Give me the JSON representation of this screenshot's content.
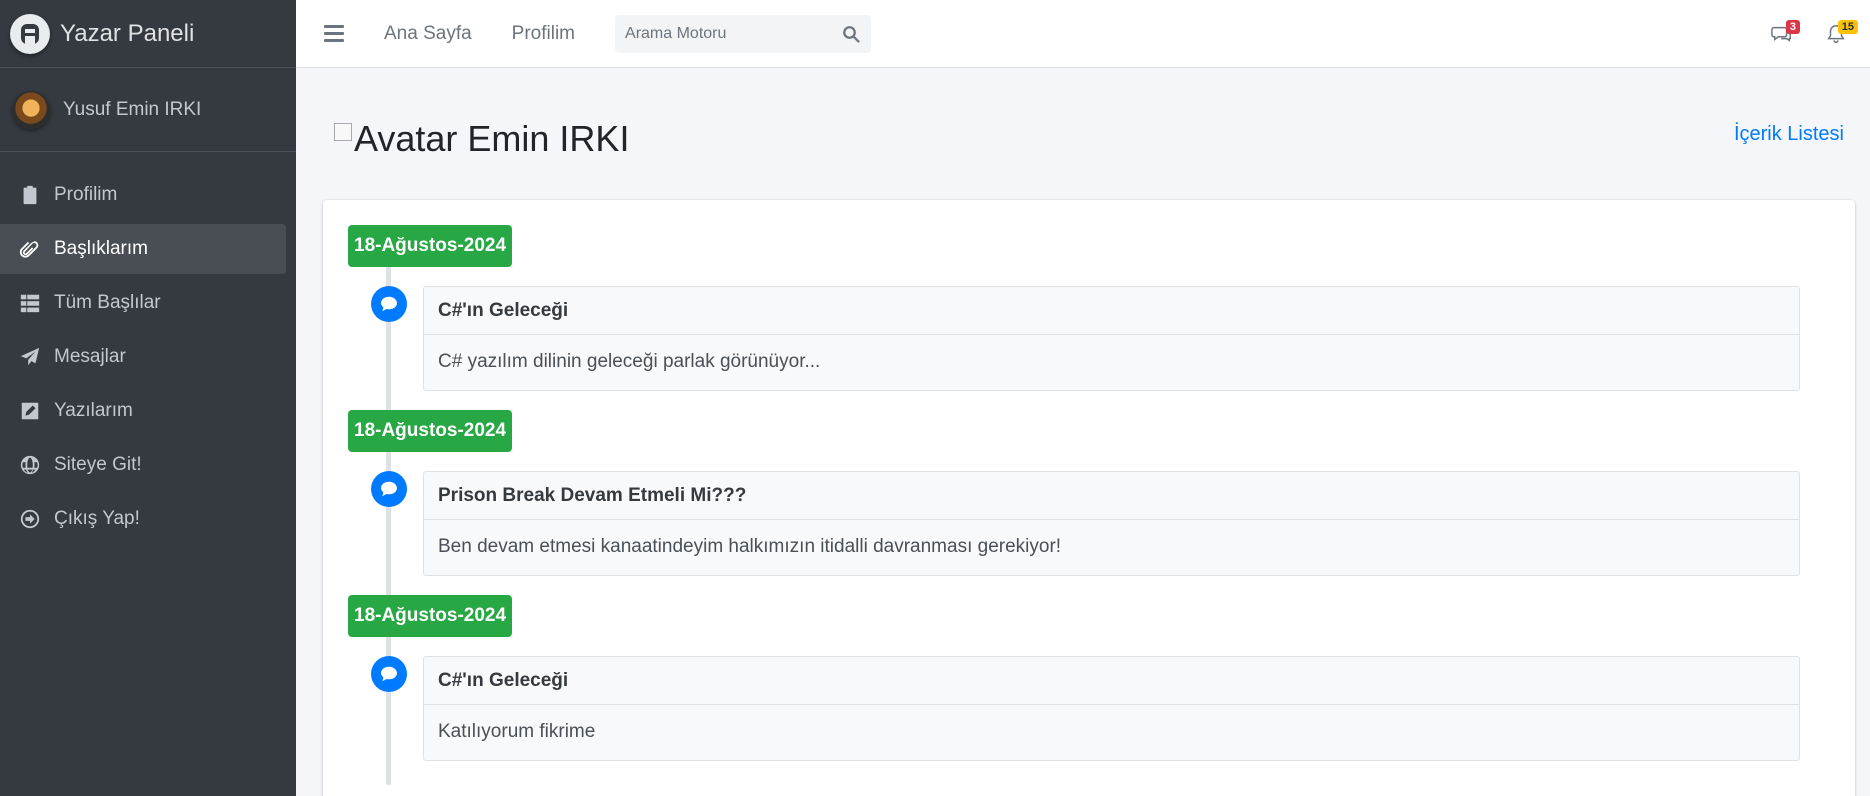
{
  "brand": {
    "title": "Yazar Paneli"
  },
  "user": {
    "name": "Yusuf Emin IRKI"
  },
  "sidebar": {
    "items": [
      {
        "label": "Profilim",
        "icon": "clipboard-icon"
      },
      {
        "label": "Başlıklarım",
        "icon": "paperclip-icon",
        "active": true
      },
      {
        "label": "Tüm Başlılar",
        "icon": "table-icon"
      },
      {
        "label": "Mesajlar",
        "icon": "paper-plane-icon"
      },
      {
        "label": "Yazılarım",
        "icon": "edit-icon"
      },
      {
        "label": "Siteye Git!",
        "icon": "globe-icon"
      },
      {
        "label": "Çıkış Yap!",
        "icon": "sign-out-icon"
      }
    ]
  },
  "topbar": {
    "links": [
      "Ana Sayfa",
      "Profilim"
    ],
    "search_placeholder": "Arama Motoru",
    "messages_count": "3",
    "notifications_count": "15"
  },
  "page": {
    "image_alt": "Avatar",
    "title": "Emin IRKI",
    "content_link": "İçerik Listesi"
  },
  "timeline": [
    {
      "date": "18-Ağustos-2024",
      "title": "C#'ın Geleceği",
      "body": "C# yazılım dilinin geleceği parlak görünüyor..."
    },
    {
      "date": "18-Ağustos-2024",
      "title": "Prison Break Devam Etmeli Mi???",
      "body": "Ben devam etmesi kanaatindeyim halkımızın itidalli davranması gerekiyor!"
    },
    {
      "date": "18-Ağustos-2024",
      "title": "C#'ın Geleceği",
      "body": "Katılıyorum fikrime"
    }
  ],
  "colors": {
    "sidebar": "#343a40",
    "accent": "#007bff",
    "date_label": "#28a745",
    "badge_red": "#dc3545",
    "badge_yellow": "#ffc107"
  }
}
